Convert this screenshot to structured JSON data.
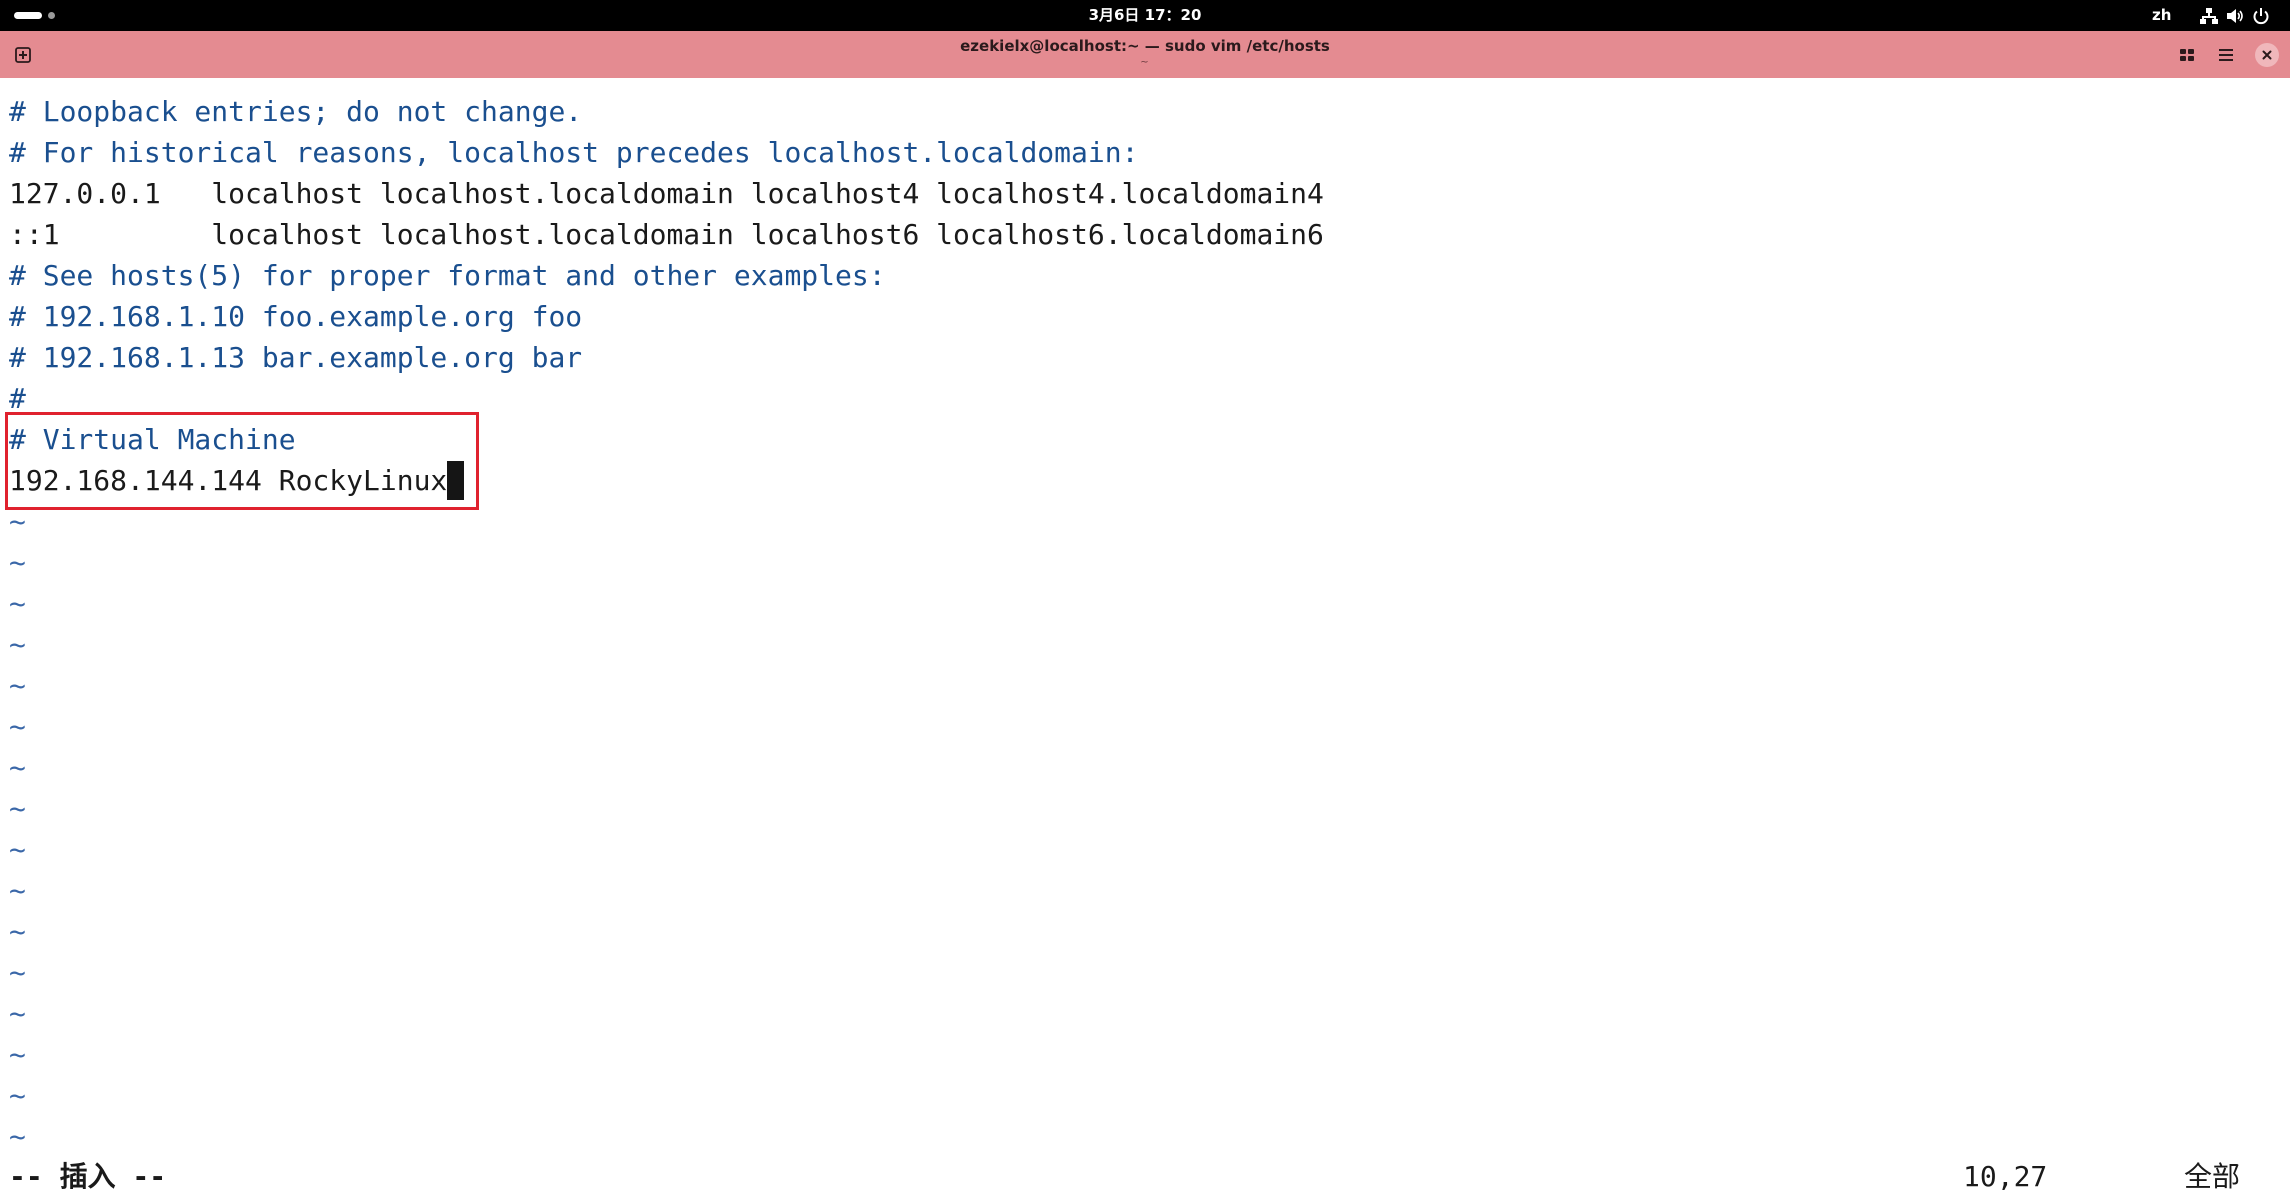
{
  "topbar": {
    "clock": "3月6日 17：20",
    "language": "zh",
    "icons": [
      "activities-indicator",
      "network-icon",
      "volume-icon",
      "power-icon"
    ]
  },
  "window": {
    "title": "ezekielx@localhost:~ — sudo vim /etc/hosts",
    "subtitle": "~",
    "buttons": [
      "new-tab-icon",
      "tab-overview-icon",
      "menu-icon",
      "close-icon"
    ]
  },
  "editor": {
    "lines": [
      {
        "text": "# Loopback entries; do not change.",
        "kind": "comment"
      },
      {
        "text": "# For historical reasons, localhost precedes localhost.localdomain:",
        "kind": "comment"
      },
      {
        "text": "127.0.0.1   localhost localhost.localdomain localhost4 localhost4.localdomain4",
        "kind": "text"
      },
      {
        "text": "::1         localhost localhost.localdomain localhost6 localhost6.localdomain6",
        "kind": "text"
      },
      {
        "text": "# See hosts(5) for proper format and other examples:",
        "kind": "comment"
      },
      {
        "text": "# 192.168.1.10 foo.example.org foo",
        "kind": "comment"
      },
      {
        "text": "# 192.168.1.13 bar.example.org bar",
        "kind": "comment"
      },
      {
        "text": "#",
        "kind": "comment"
      },
      {
        "text": "# Virtual Machine",
        "kind": "comment"
      },
      {
        "text": "192.168.144.144 RockyLinux",
        "kind": "text"
      }
    ],
    "tilde": "~",
    "tilde_count": 16,
    "colors": {
      "comment": "#1a4f8f",
      "text": "#1a1a1a",
      "highlight_border": "#e0222e"
    }
  },
  "statusline": {
    "mode": "-- 插入 --",
    "position": "10,27",
    "scroll": "全部"
  },
  "theme": {
    "titlebar_color": "#e48b91",
    "topbar_color": "#000000"
  }
}
